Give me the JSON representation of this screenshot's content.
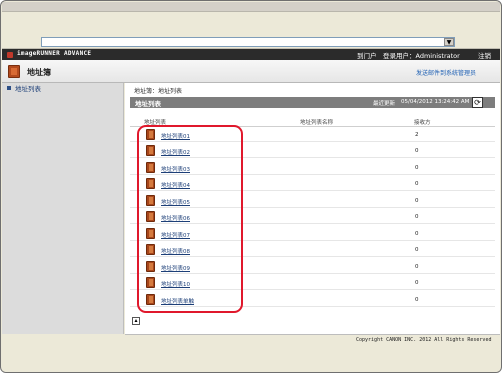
{
  "brand": {
    "name": "imageRUNNER ADVANCE",
    "portal": "到门户",
    "login_user": "登录用户：Administrator",
    "logout": "注销"
  },
  "header": {
    "title": "地址簿",
    "mail_admin": "发送邮件到系统管理员"
  },
  "sidebar": {
    "items": [
      {
        "label": "地址列表"
      }
    ]
  },
  "breadcrumb": "地址簿：地址列表",
  "panel": {
    "title": "地址列表",
    "last_updated_label": "最近更新",
    "last_updated_value": "05/04/2012 13:24:42 AM"
  },
  "columns": {
    "name": "地址列表",
    "list_name": "地址列表名称",
    "count": "接收方"
  },
  "rows": [
    {
      "label": "地址列表01",
      "count": "2"
    },
    {
      "label": "地址列表02",
      "count": "0"
    },
    {
      "label": "地址列表03",
      "count": "0"
    },
    {
      "label": "地址列表04",
      "count": "0"
    },
    {
      "label": "地址列表05",
      "count": "0"
    },
    {
      "label": "地址列表06",
      "count": "0"
    },
    {
      "label": "地址列表07",
      "count": "0"
    },
    {
      "label": "地址列表08",
      "count": "0"
    },
    {
      "label": "地址列表09",
      "count": "0"
    },
    {
      "label": "地址列表10",
      "count": "0"
    },
    {
      "label": "地址列表单触",
      "count": "0"
    }
  ],
  "footer": {
    "copyright": "Copyright CANON INC. 2012 All Rights Reserved"
  },
  "icons": {
    "refresh": "refresh-icon",
    "book": "address-book-icon",
    "back_to_top": "arrow-up-icon"
  },
  "colors": {
    "highlight": "#e0182c",
    "brandbar": "#2b2b2b",
    "link": "#1d3f78"
  }
}
